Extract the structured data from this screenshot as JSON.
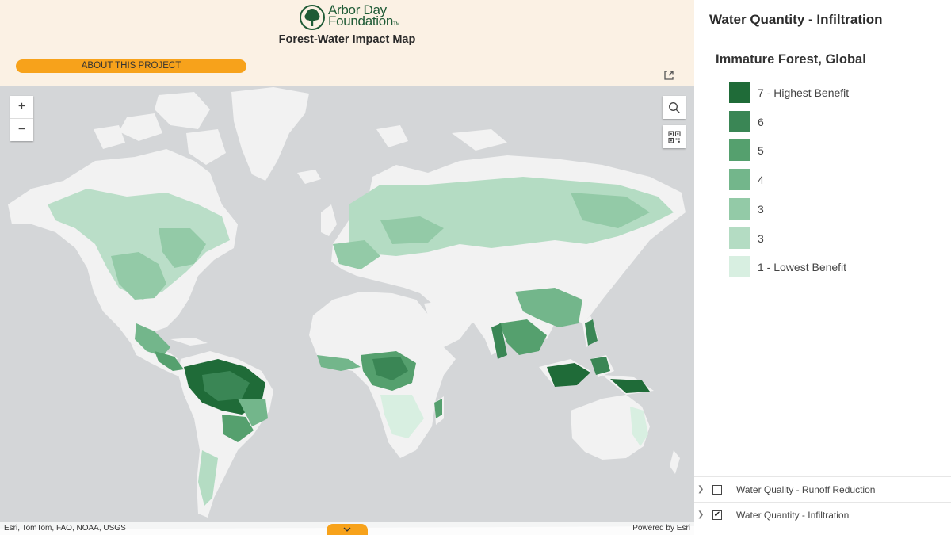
{
  "header": {
    "logo_line1": "Arbor Day",
    "logo_line2": "Foundation",
    "logo_tm": "TM",
    "title": "Forest-Water Impact Map",
    "about_label": "ABOUT THIS PROJECT"
  },
  "map": {
    "zoom_in": "+",
    "zoom_out": "−",
    "attribution_left": "Esri, TomTom, FAO, NOAA, USGS",
    "attribution_right": "Powered by Esri",
    "colors": {
      "ocean": "#d4d6d8",
      "land": "#f2f2f2"
    }
  },
  "panel": {
    "title": "Water Quantity - Infiltration",
    "legend_heading": "Immature Forest, Global",
    "legend": [
      {
        "label": "7 - Highest Benefit",
        "color": "#1f6b38"
      },
      {
        "label": "6",
        "color": "#3a8655"
      },
      {
        "label": "5",
        "color": "#55a06e"
      },
      {
        "label": "4",
        "color": "#73b68b"
      },
      {
        "label": "3",
        "color": "#93caa7"
      },
      {
        "label": "3",
        "color": "#b4dcc3"
      },
      {
        "label": "1 - Lowest Benefit",
        "color": "#d8efe1"
      }
    ],
    "layers": [
      {
        "label": "Water Quality - Runoff Reduction",
        "checked": false
      },
      {
        "label": "Water Quantity - Infiltration",
        "checked": true
      }
    ]
  },
  "colors": {
    "accent": "#f7a21b",
    "brand_green": "#1f5b36",
    "header_bg": "#fbf1e4"
  }
}
